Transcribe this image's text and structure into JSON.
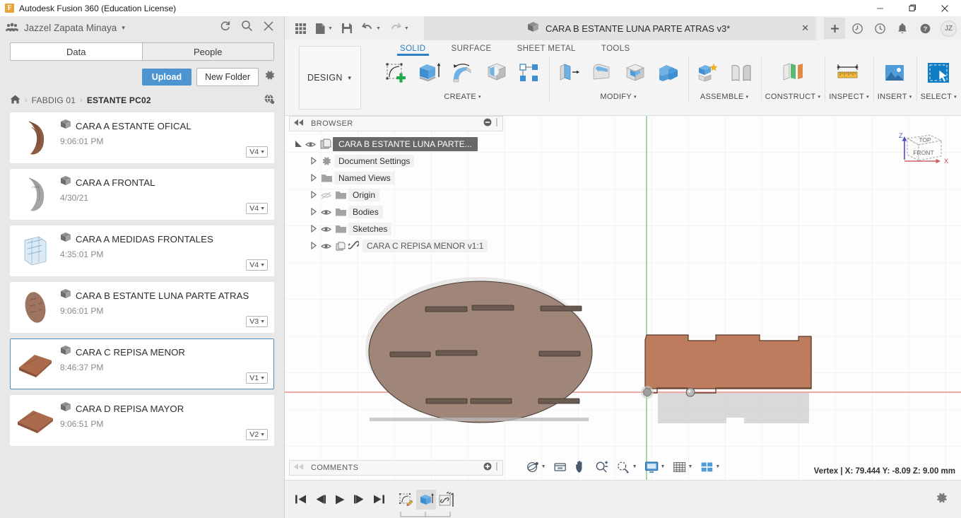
{
  "window": {
    "title": "Autodesk Fusion 360 (Education License)",
    "minimize": "—",
    "maximize": "❐",
    "close": "✕"
  },
  "data_panel": {
    "user": {
      "name": "Jazzel Zapata Minaya",
      "caret": "▾",
      "people_icon": "people-icon",
      "refresh_icon": "refresh-icon",
      "search_icon": "search-icon",
      "close_icon": "close-icon"
    },
    "tabs": [
      {
        "label": "Data",
        "active": true
      },
      {
        "label": "People",
        "active": false
      }
    ],
    "actions": {
      "upload": "Upload",
      "new_folder": "New Folder",
      "settings_icon": "gear-icon"
    },
    "breadcrumb": {
      "home_icon": "home-icon",
      "separator": "›",
      "items": [
        "FABDIG 01",
        "ESTANTE PC02"
      ],
      "globe_icon": "globe-share-icon"
    },
    "items": [
      {
        "name": "CARA A ESTANTE OFICAL",
        "time": "9:06:01 PM",
        "version": "V4",
        "thumb": "crescent-brown",
        "selected": false
      },
      {
        "name": "CARA A FRONTAL",
        "time": "4/30/21",
        "version": "V4",
        "thumb": "crescent-gray",
        "selected": false
      },
      {
        "name": "CARA A MEDIDAS FRONTALES",
        "time": "4:35:01 PM",
        "version": "V4",
        "thumb": "sketch-blue",
        "selected": false
      },
      {
        "name": "CARA B ESTANTE LUNA PARTE ATRAS",
        "time": "9:06:01 PM",
        "version": "V3",
        "thumb": "ellipse-brown",
        "selected": false
      },
      {
        "name": "CARA C REPISA MENOR",
        "time": "8:46:37 PM",
        "version": "V1",
        "thumb": "plank-brown",
        "selected": true
      },
      {
        "name": "CARA D REPISA MAYOR",
        "time": "9:06:51 PM",
        "version": "V2",
        "thumb": "plank-long-brown",
        "selected": false
      }
    ]
  },
  "quick_access": {
    "grid_icon": "app-grid-icon",
    "new_icon": "new-file-icon",
    "save_icon": "save-icon",
    "undo_icon": "undo-icon",
    "redo_icon": "redo-icon",
    "document_tab": {
      "title": "CARA  B ESTANTE LUNA PARTE ATRAS v3*",
      "close": "✕",
      "cube_icon": "document-cube-icon"
    },
    "right_icons": [
      {
        "name": "add-tab-icon",
        "glyph": "+"
      },
      {
        "name": "job-status-icon",
        "glyph": "◴"
      },
      {
        "name": "recent-activity-icon",
        "glyph": "◴"
      },
      {
        "name": "notifications-bell-icon",
        "glyph": "✉"
      },
      {
        "name": "help-icon",
        "glyph": "?"
      }
    ],
    "avatar_initials": "JZ"
  },
  "ribbon": {
    "workspace": {
      "label": "DESIGN",
      "caret": "▾"
    },
    "tabs": [
      {
        "label": "SOLID",
        "active": true
      },
      {
        "label": "SURFACE",
        "active": false
      },
      {
        "label": "SHEET METAL",
        "active": false
      },
      {
        "label": "TOOLS",
        "active": false
      }
    ],
    "panels": [
      {
        "label": "CREATE",
        "caret": "▾",
        "icons": [
          "create-sketch-icon",
          "extrude-icon",
          "revolve-icon",
          "sweep-icon",
          "pattern-icon"
        ]
      },
      {
        "label": "MODIFY",
        "caret": "▾",
        "icons": [
          "press-pull-icon",
          "fillet-icon",
          "shell-icon",
          "combine-icon"
        ]
      },
      {
        "label": "ASSEMBLE",
        "caret": "▾",
        "icons": [
          "new-component-icon",
          "joint-icon"
        ]
      },
      {
        "label": "CONSTRUCT",
        "caret": "▾",
        "icons": [
          "offset-plane-icon"
        ]
      },
      {
        "label": "INSPECT",
        "caret": "▾",
        "icons": [
          "measure-icon"
        ]
      },
      {
        "label": "INSERT",
        "caret": "▾",
        "icons": [
          "insert-image-icon"
        ]
      },
      {
        "label": "SELECT",
        "caret": "▾",
        "icons": [
          "select-window-icon"
        ]
      }
    ]
  },
  "browser": {
    "header": {
      "collapse_icon": "collapse-left-icon",
      "title": "BROWSER",
      "minimize_icon": "minimize-circle-icon",
      "grip_icon": "grip-icon"
    },
    "nodes": [
      {
        "label": "CARA  B ESTANTE LUNA PARTE...",
        "icon": "component-icon",
        "root": true,
        "expanded": true,
        "eye": true,
        "radio": "activate-radio-icon"
      },
      {
        "label": "Document Settings",
        "icon": "gear-icon",
        "root": false,
        "eye": false
      },
      {
        "label": "Named Views",
        "icon": "folder-icon",
        "root": false,
        "eye": false
      },
      {
        "label": "Origin",
        "icon": "folder-icon",
        "root": false,
        "eye": true,
        "dimmed_eye": true
      },
      {
        "label": "Bodies",
        "icon": "folder-icon",
        "root": false,
        "eye": true
      },
      {
        "label": "Sketches",
        "icon": "folder-icon",
        "root": false,
        "eye": true
      },
      {
        "label": "CARA C REPISA  MENOR v1:1",
        "icon": "linked-component-icon",
        "root": false,
        "eye": true,
        "linked": true
      }
    ]
  },
  "viewport": {
    "viewcube": {
      "top_label": "TOP",
      "front_label": "FRONT",
      "axis_x": "X",
      "axis_z": "Z"
    },
    "bodies": [
      {
        "name": "ellipse-shelf-back-body",
        "color": "#a08579"
      },
      {
        "name": "shelf-plank-body",
        "color": "#bd7c5e"
      }
    ],
    "grid_color": "#e8e8e8",
    "x_axis_color": "#e86d6d",
    "y_axis_color": "#6fc06f"
  },
  "comments": {
    "title": "COMMENTS",
    "add_icon": "add-comment-icon",
    "grip_icon": "grip-icon"
  },
  "navbar": {
    "buttons": [
      {
        "name": "orbit-icon",
        "caret": "▾"
      },
      {
        "name": "look-at-icon",
        "caret": ""
      },
      {
        "name": "pan-icon",
        "caret": ""
      },
      {
        "name": "zoom-icon",
        "caret": ""
      },
      {
        "name": "zoom-window-icon",
        "caret": "▾"
      },
      {
        "name": "display-settings-icon",
        "caret": "▾"
      },
      {
        "name": "grid-snaps-icon",
        "caret": "▾"
      },
      {
        "name": "viewports-icon",
        "caret": "▾"
      }
    ]
  },
  "status_bar": {
    "text": "Vertex | X: 79.444 Y: -8.09 Z: 9.00 mm"
  },
  "timeline": {
    "controls": [
      {
        "name": "go-to-beginning-button",
        "glyph": "skip-back"
      },
      {
        "name": "step-back-button",
        "glyph": "step-back"
      },
      {
        "name": "play-button",
        "glyph": "play"
      },
      {
        "name": "step-forward-button",
        "glyph": "step-fwd"
      },
      {
        "name": "go-to-end-button",
        "glyph": "skip-fwd"
      }
    ],
    "features": [
      {
        "name": "timeline-sketch-feature",
        "icon": "sketch-feature-icon"
      },
      {
        "name": "timeline-extrude-feature",
        "icon": "extrude-feature-icon"
      },
      {
        "name": "timeline-linked-feature",
        "icon": "linked-feature-icon"
      }
    ],
    "settings_icon": "gear-icon"
  }
}
